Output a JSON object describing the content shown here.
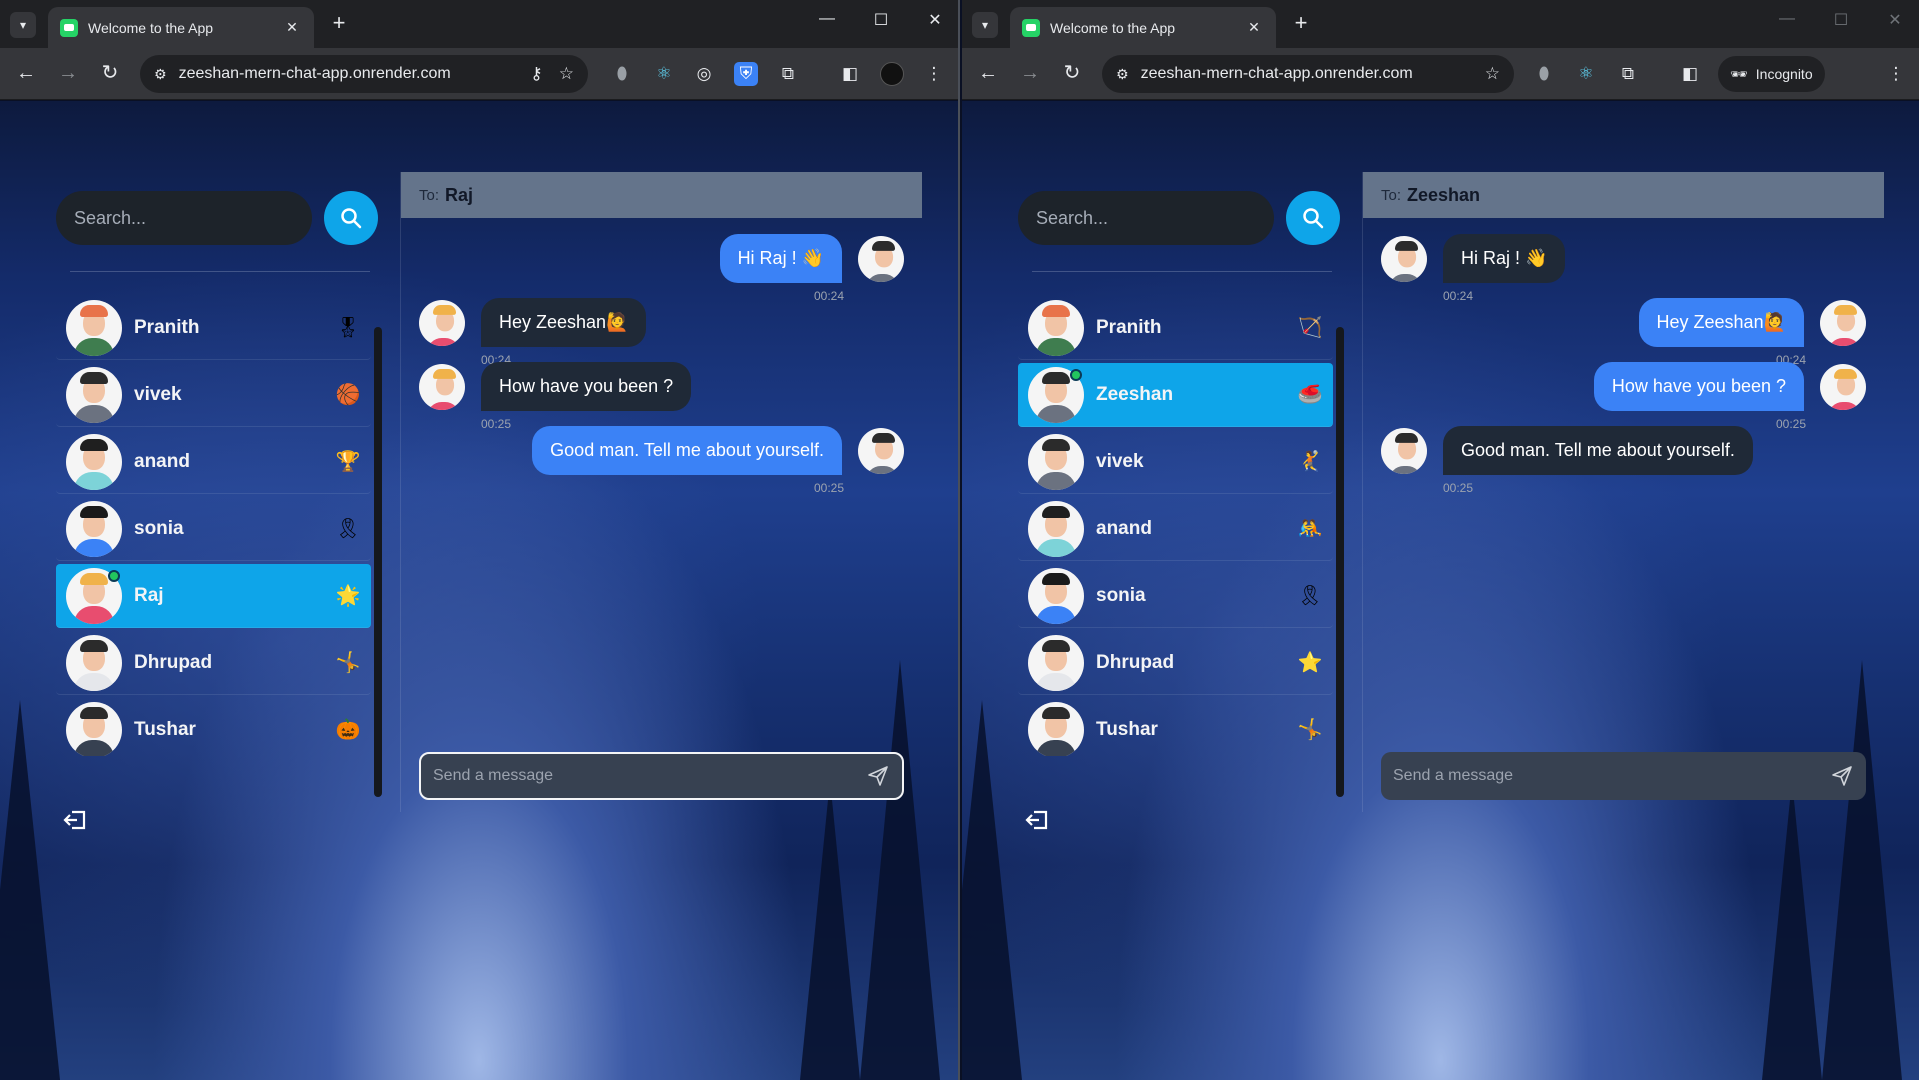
{
  "windows": [
    {
      "tab_title": "Welcome to the App",
      "url": "zeeshan-mern-chat-app.onrender.com",
      "incognito_label": null,
      "search_placeholder": "Search...",
      "to_label": "To:",
      "to_name": "Raj",
      "composer_placeholder": "Send a message",
      "conversations": [
        {
          "name": "Pranith",
          "emoji": "🎖",
          "hair": "#e8734a",
          "shirt": "#3f7d4f"
        },
        {
          "name": "vivek",
          "emoji": "🏀",
          "hair": "#2b2b2b",
          "shirt": "#6b7280"
        },
        {
          "name": "anand",
          "emoji": "🏆",
          "hair": "#1f1f1f",
          "shirt": "#7dd3d8"
        },
        {
          "name": "sonia",
          "emoji": "🎗",
          "hair": "#1a1a1a",
          "shirt": "#3b82f6"
        },
        {
          "name": "Raj",
          "emoji": "🌟",
          "hair": "#f0b24a",
          "shirt": "#e84d6f",
          "selected": true,
          "online": true
        },
        {
          "name": "Dhrupad",
          "emoji": "🤸",
          "hair": "#2b2b2b",
          "shirt": "#e5e7eb"
        },
        {
          "name": "Tushar",
          "emoji": "🎃",
          "hair": "#2b2b2b",
          "shirt": "#374151"
        }
      ],
      "messages": [
        {
          "dir": "out",
          "text": "Hi Raj ! 👋",
          "time": "00:24"
        },
        {
          "dir": "in",
          "text": "Hey Zeeshan🙋",
          "time": "00:24"
        },
        {
          "dir": "in",
          "text": "How have you been ?",
          "time": "00:25"
        },
        {
          "dir": "out",
          "text": "Good man. Tell me about yourself.",
          "time": "00:25"
        }
      ]
    },
    {
      "tab_title": "Welcome to the App",
      "url": "zeeshan-mern-chat-app.onrender.com",
      "incognito_label": "Incognito",
      "search_placeholder": "Search...",
      "to_label": "To:",
      "to_name": "Zeeshan",
      "composer_placeholder": "Send a message",
      "conversations": [
        {
          "name": "Pranith",
          "emoji": "🏹",
          "hair": "#e8734a",
          "shirt": "#3f7d4f"
        },
        {
          "name": "Zeeshan",
          "emoji": "🥌",
          "hair": "#2b2b2b",
          "shirt": "#6b7280",
          "selected": true,
          "online": true
        },
        {
          "name": "vivek",
          "emoji": "🤾",
          "hair": "#2b2b2b",
          "shirt": "#6b7280"
        },
        {
          "name": "anand",
          "emoji": "🤼",
          "hair": "#1f1f1f",
          "shirt": "#7dd3d8"
        },
        {
          "name": "sonia",
          "emoji": "🎗",
          "hair": "#1a1a1a",
          "shirt": "#3b82f6"
        },
        {
          "name": "Dhrupad",
          "emoji": "⭐",
          "hair": "#2b2b2b",
          "shirt": "#e5e7eb"
        },
        {
          "name": "Tushar",
          "emoji": "🤸",
          "hair": "#2b2b2b",
          "shirt": "#374151"
        }
      ],
      "messages": [
        {
          "dir": "in",
          "text": "Hi Raj ! 👋",
          "time": "00:24"
        },
        {
          "dir": "out",
          "text": "Hey Zeeshan🙋",
          "time": "00:24"
        },
        {
          "dir": "out",
          "text": "How have you been ?",
          "time": "00:25"
        },
        {
          "dir": "in",
          "text": "Good man. Tell me about yourself.",
          "time": "00:25"
        }
      ]
    }
  ],
  "colors": {
    "accent": "#0ea5e9",
    "bubble_out": "#3b82f6",
    "bubble_in": "#1f2937",
    "header": "#64748b",
    "online": "#22c55e"
  },
  "icons": [
    "tab-search-icon",
    "favicon-chat-icon",
    "close-icon",
    "plus-icon",
    "minimize-icon",
    "maximize-icon",
    "back-icon",
    "forward-icon",
    "reload-icon",
    "site-info-icon",
    "key-icon",
    "star-icon",
    "extension-icon",
    "sidepanel-icon",
    "menu-icon",
    "incognito-icon",
    "search-icon",
    "logout-icon",
    "send-icon"
  ]
}
